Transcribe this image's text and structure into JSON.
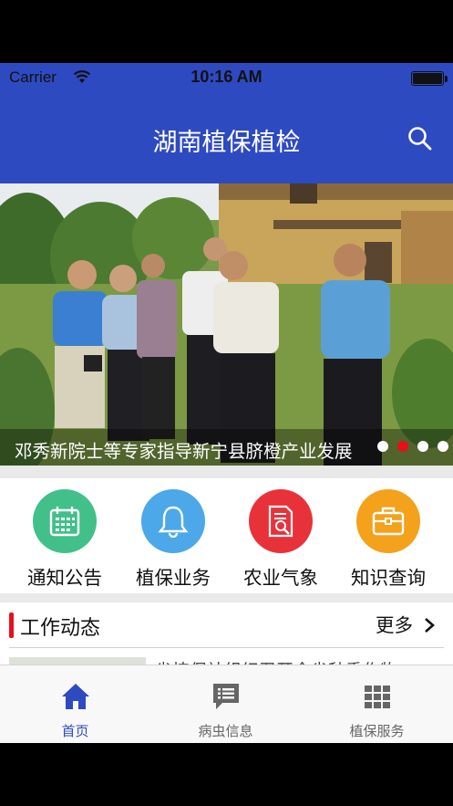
{
  "status_bar": {
    "carrier": "Carrier",
    "time": "10:16 AM"
  },
  "header": {
    "title": "湖南植保植检",
    "search_icon": "search-icon"
  },
  "banner": {
    "caption": "邓秀新院士等专家指导新宁县脐橙产业发展",
    "active_slide": 2,
    "slide_count": 4
  },
  "categories": [
    {
      "label": "通知公告",
      "icon": "calendar-icon",
      "color": "#42C08A"
    },
    {
      "label": "植保业务",
      "icon": "bell-icon",
      "color": "#4CA8E8"
    },
    {
      "label": "农业气象",
      "icon": "report-search-icon",
      "color": "#E8323A"
    },
    {
      "label": "知识查询",
      "icon": "briefcase-icon",
      "color": "#F4A11C"
    }
  ],
  "news": {
    "title": "工作动态",
    "more": "更多",
    "first_item_title": "省植保站组织召开全省秋季作物"
  },
  "tabs": [
    {
      "label": "首页",
      "icon": "home-icon",
      "active": true
    },
    {
      "label": "病虫信息",
      "icon": "message-list-icon",
      "active": false
    },
    {
      "label": "植保服务",
      "icon": "grid-icon",
      "active": false
    }
  ],
  "colors": {
    "primary": "#2E4AC0",
    "accent_red": "#E5111A",
    "tab_active": "#2E4AC0",
    "tab_inactive": "#666666"
  }
}
